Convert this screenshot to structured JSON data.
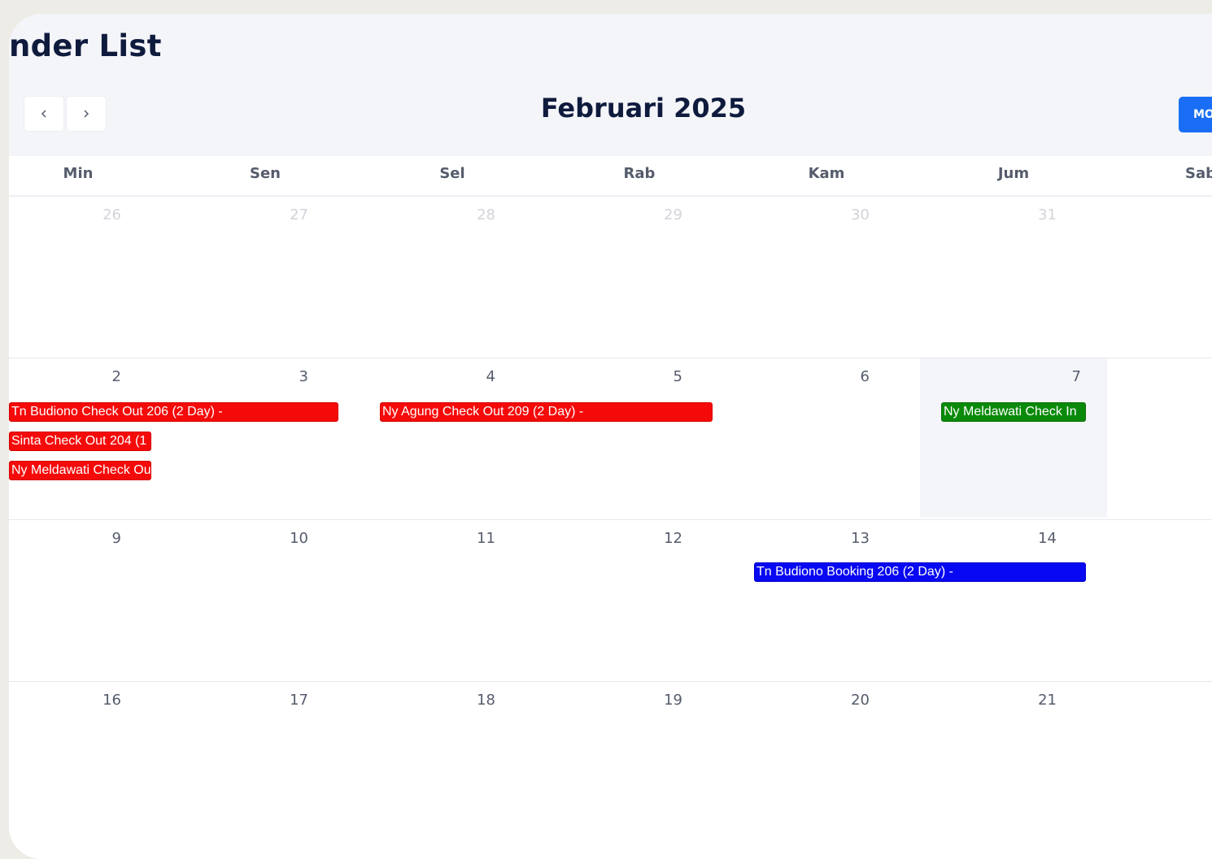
{
  "header": {
    "title": "nder List"
  },
  "toolbar": {
    "prev_icon": "chevron-left-icon",
    "next_icon": "chevron-right-icon",
    "month_title": "Februari 2025",
    "view_button_label": "MO",
    "accent_color": "#1a6ef5"
  },
  "calendar": {
    "weekdays": [
      "Min",
      "Sen",
      "Sel",
      "Rab",
      "Kam",
      "Jum",
      "Sab"
    ],
    "weeks": [
      {
        "days": [
          "26",
          "27",
          "28",
          "29",
          "30",
          "31"
        ]
      },
      {
        "days": [
          "2",
          "3",
          "4",
          "5",
          "6",
          "7"
        ]
      },
      {
        "days": [
          "9",
          "10",
          "11",
          "12",
          "13",
          "14"
        ]
      },
      {
        "days": [
          "16",
          "17",
          "18",
          "19",
          "20",
          "21"
        ]
      }
    ],
    "events": [
      {
        "label": "Tn Budiono Check Out 206 (2 Day) -",
        "color": "#f50a0a"
      },
      {
        "label": "Sinta Check Out 204 (1",
        "color": "#f50a0a"
      },
      {
        "label": "Ny Meldawati Check Ou",
        "color": "#f50a0a"
      },
      {
        "label": "Ny Agung Check Out 209 (2 Day) -",
        "color": "#f50a0a"
      },
      {
        "label": "Ny Meldawati Check In",
        "color": "#0a8a0a"
      },
      {
        "label": "Tn Budiono Booking 206 (2 Day) -",
        "color": "#0808f2"
      }
    ]
  }
}
